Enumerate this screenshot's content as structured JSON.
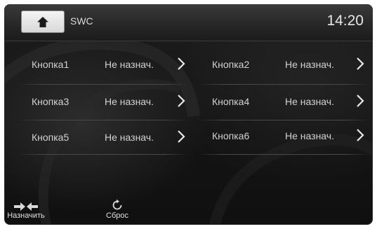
{
  "header": {
    "title": "SWC",
    "clock": "14:20"
  },
  "buttons": [
    {
      "label": "Кнопка1",
      "value": "Не назнач."
    },
    {
      "label": "Кнопка2",
      "value": "Не назнач."
    },
    {
      "label": "Кнопка3",
      "value": "Не назнач."
    },
    {
      "label": "Кнопка4",
      "value": "Не назнач."
    },
    {
      "label": "Кнопка5",
      "value": "Не назнач."
    },
    {
      "label": "Кнопка6",
      "value": "Не назнач."
    }
  ],
  "footer": {
    "assign_label": "Назначить",
    "reset_label": "Сброс"
  },
  "icons": {
    "home": "home-icon",
    "chevron": "chevron-right-icon",
    "assign": "arrows-converge-icon",
    "reset": "refresh-icon"
  },
  "colors": {
    "background": "#141414",
    "text": "#d2d2d2",
    "home_button": "#e8e8e8"
  }
}
